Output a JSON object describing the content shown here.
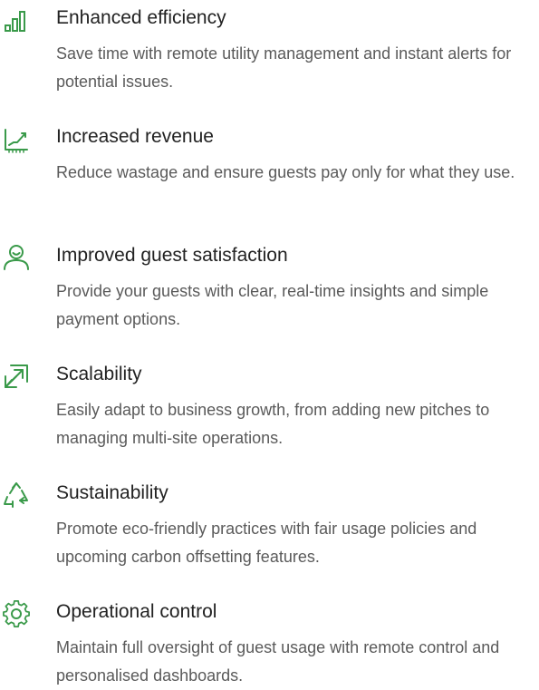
{
  "features": [
    {
      "icon": "bar-chart-icon",
      "title": "Enhanced efficiency",
      "description": "Save time with remote utility management and instant alerts for potential issues."
    },
    {
      "icon": "trending-up-chart-icon",
      "title": "Increased revenue",
      "description": "Reduce wastage and ensure guests pay only for what they use."
    },
    {
      "icon": "user-smile-icon",
      "title": "Improved guest satisfaction",
      "description": "Provide your guests with clear, real-time insights and simple payment options."
    },
    {
      "icon": "expand-arrow-icon",
      "title": "Scalability",
      "description": "Easily adapt to business growth, from adding new pitches to managing multi-site operations."
    },
    {
      "icon": "recycle-icon",
      "title": "Sustainability",
      "description": "Promote eco-friendly practices with fair usage policies and upcoming carbon offsetting features."
    },
    {
      "icon": "gear-icon",
      "title": "Operational control",
      "description": "Maintain full oversight of guest usage with remote control and personalised dashboards."
    }
  ],
  "colors": {
    "icon": "#3a9a4a",
    "title": "#222222",
    "text": "#5a5a5a"
  }
}
